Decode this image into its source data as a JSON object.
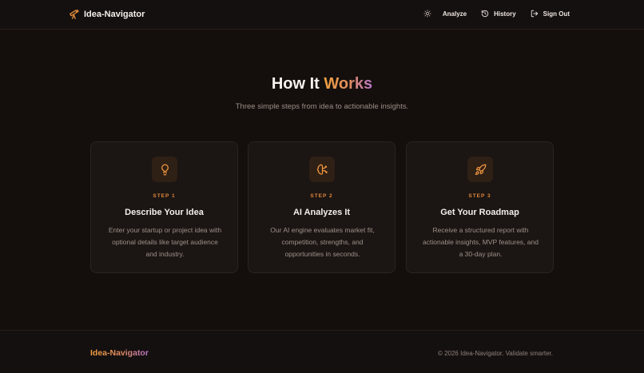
{
  "header": {
    "brand": "Idea-Navigator",
    "brand_icon": "telescope-icon",
    "theme_icon": "sun-icon",
    "nav": [
      {
        "label": "Analyze"
      },
      {
        "label": "History",
        "icon": "history-icon"
      },
      {
        "label": "Sign Out",
        "icon": "sign-out-icon"
      }
    ]
  },
  "hero": {
    "title_main": "How It ",
    "title_accent": "Works",
    "subtitle": "Three simple steps from idea to actionable insights."
  },
  "steps": [
    {
      "step": "STEP 1",
      "title": "Describe Your Idea",
      "description": "Enter your startup or project idea with optional details like target audience and industry.",
      "icon": "lightbulb-icon"
    },
    {
      "step": "STEP 2",
      "title": "AI Analyzes It",
      "description": "Our AI engine evaluates market fit, competition, strengths, and opportunities in seconds.",
      "icon": "brain-icon"
    },
    {
      "step": "STEP 3",
      "title": "Get Your Roadmap",
      "description": "Receive a structured report with actionable insights, MVP features, and a 30-day plan.",
      "icon": "rocket-icon"
    }
  ],
  "footer": {
    "brand": "Idea-Navigator",
    "copyright": "© 2026 Idea-Navigator. Validate smarter."
  },
  "colors": {
    "background": "#140f0d",
    "accent": "#e0883a",
    "accent_gradient_end": "#b777c9",
    "card_bg": "#1b1513"
  }
}
